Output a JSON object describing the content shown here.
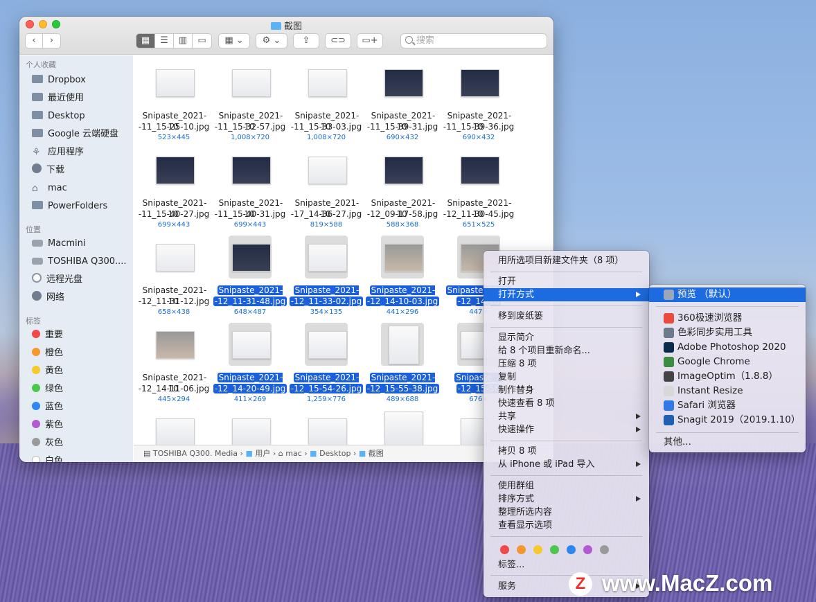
{
  "window": {
    "title": "截图",
    "search_placeholder": "搜索",
    "action_glyph": "⚙",
    "view_glyph": "▦"
  },
  "sidebar": {
    "favorites_header": "个人收藏",
    "favorites": [
      {
        "label": "Dropbox",
        "icon": "folder-icon"
      },
      {
        "label": "最近使用",
        "icon": "folder-icon"
      },
      {
        "label": "Desktop",
        "icon": "folder-icon"
      },
      {
        "label": "Google 云端硬盘",
        "icon": "folder-icon"
      },
      {
        "label": "应用程序",
        "icon": "applications-icon"
      },
      {
        "label": "下载",
        "icon": "download-icon"
      },
      {
        "label": "mac",
        "icon": "home-icon"
      },
      {
        "label": "PowerFolders",
        "icon": "folder-icon"
      }
    ],
    "locations_header": "位置",
    "locations": [
      {
        "label": "Macmini",
        "icon": "computer-icon"
      },
      {
        "label": "TOSHIBA Q300....",
        "icon": "disk-icon"
      },
      {
        "label": "远程光盘",
        "icon": "disc-icon"
      },
      {
        "label": "网络",
        "icon": "network-icon"
      }
    ],
    "tags_header": "标签",
    "tags": [
      {
        "label": "重要",
        "color": "#f0494a"
      },
      {
        "label": "橙色",
        "color": "#f5982f"
      },
      {
        "label": "黄色",
        "color": "#f5c92f"
      },
      {
        "label": "绿色",
        "color": "#4cc74c"
      },
      {
        "label": "蓝色",
        "color": "#2e86f0"
      },
      {
        "label": "紫色",
        "color": "#b45ad0"
      },
      {
        "label": "灰色",
        "color": "#9a9a9a"
      },
      {
        "label": "白色",
        "color": "#ffffff"
      }
    ]
  },
  "files": [
    [
      {
        "name1": "Snipaste_2021-10",
        "name2": "-11_15-25-10.jpg",
        "dims": "523×445",
        "sel": false
      },
      {
        "name1": "Snipaste_2021-10",
        "name2": "-11_15-32-57.jpg",
        "dims": "1,008×720",
        "sel": false
      },
      {
        "name1": "Snipaste_2021-10",
        "name2": "-11_15-33-03.jpg",
        "dims": "1,008×720",
        "sel": false
      },
      {
        "name1": "Snipaste_2021-10",
        "name2": "-11_15-39-31.jpg",
        "dims": "690×432",
        "sel": false
      },
      {
        "name1": "Snipaste_2021-10",
        "name2": "-11_15-39-36.jpg",
        "dims": "690×432",
        "sel": false
      }
    ],
    [
      {
        "name1": "Snipaste_2021-10",
        "name2": "-11_15-40-27.jpg",
        "dims": "699×443",
        "sel": false
      },
      {
        "name1": "Snipaste_2021-10",
        "name2": "-11_15-40-31.jpg",
        "dims": "699×443",
        "sel": false
      },
      {
        "name1": "Snipaste_2021-10",
        "name2": "-17_14-36-27.jpg",
        "dims": "819×588",
        "sel": false
      },
      {
        "name1": "Snipaste_2021-10",
        "name2": "-12_09-17-58.jpg",
        "dims": "588×368",
        "sel": false
      },
      {
        "name1": "Snipaste_2021-10",
        "name2": "-12_11-30-45.jpg",
        "dims": "651×525",
        "sel": false
      }
    ],
    [
      {
        "name1": "Snipaste_2021-10",
        "name2": "-12_11-31-12.jpg",
        "dims": "658×438",
        "sel": false
      },
      {
        "name1": "Snipaste_2021-10",
        "name2": "-12_11-31-48.jpg",
        "dims": "648×487",
        "sel": true
      },
      {
        "name1": "Snipaste_2021-10",
        "name2": "-12_11-33-02.jpg",
        "dims": "354×135",
        "sel": true
      },
      {
        "name1": "Snipaste_2021-10",
        "name2": "-12_14-10-03.jpg",
        "dims": "441×296",
        "sel": true
      },
      {
        "name1": "Snipaste_2021-10",
        "name2": "-12_14-10",
        "dims": "447×",
        "sel": true
      }
    ],
    [
      {
        "name1": "Snipaste_2021-10",
        "name2": "-12_14-11-06.jpg",
        "dims": "445×294",
        "sel": false
      },
      {
        "name1": "Snipaste_2021-10",
        "name2": "-12_14-20-49.jpg",
        "dims": "411×269",
        "sel": true
      },
      {
        "name1": "Snipaste_2021-10",
        "name2": "-12_15-54-26.jpg",
        "dims": "1,259×776",
        "sel": true
      },
      {
        "name1": "Snipaste_2021-10",
        "name2": "-12_15-55-38.jpg",
        "dims": "489×688",
        "sel": true
      },
      {
        "name1": "Snipaste_2",
        "name2": "-12_15-56",
        "dims": "676×",
        "sel": true
      }
    ]
  ],
  "pathbar": [
    "TOSHIBA Q300. Media",
    "用户",
    "mac",
    "Desktop",
    "截图"
  ],
  "menu": {
    "new_folder": "用所选项目新建文件夹（8 项）",
    "open": "打开",
    "open_with": "打开方式",
    "trash": "移到废纸篓",
    "get_info": "显示简介",
    "rename": "给 8 个项目重新命名...",
    "compress": "压缩 8 项",
    "duplicate": "复制",
    "alias": "制作替身",
    "quicklook": "快速查看 8 项",
    "share": "共享",
    "quick_actions": "快速操作",
    "copy": "拷贝 8 项",
    "import": "从 iPhone 或 iPad 导入",
    "use_groups": "使用群组",
    "sort_by": "排序方式",
    "clean_up": "整理所选内容",
    "view_options": "查看显示选项",
    "tags": "标签...",
    "services": "服务",
    "tag_colors": [
      "#f0494a",
      "#f5982f",
      "#f5c92f",
      "#4cc74c",
      "#2e86f0",
      "#b45ad0",
      "#9a9a9a"
    ]
  },
  "submenu": {
    "items": [
      {
        "label": "预览 （默认）",
        "icon": "preview-icon",
        "color": "#9aa7b8"
      },
      {
        "label": "360极速浏览器",
        "icon": "360-browser-icon",
        "color": "#e94b3c"
      },
      {
        "label": "色彩同步实用工具",
        "icon": "colorsync-icon",
        "color": "#6c7a8a"
      },
      {
        "label": "Adobe Photoshop 2020",
        "icon": "photoshop-icon",
        "color": "#0b2b4b"
      },
      {
        "label": "Google Chrome",
        "icon": "chrome-icon",
        "color": "#3c8d40"
      },
      {
        "label": "ImageOptim（1.8.8）",
        "icon": "imageoptim-icon",
        "color": "#444444"
      },
      {
        "label": "Instant Resize",
        "icon": "instant-resize-icon",
        "color": "#d8d8d8"
      },
      {
        "label": "Safari 浏览器",
        "icon": "safari-icon",
        "color": "#2f7ae5"
      },
      {
        "label": "Snagit 2019（2019.1.10）",
        "icon": "snagit-icon",
        "color": "#1f5fb4"
      }
    ],
    "other": "其他..."
  },
  "watermark": {
    "logo": "Z",
    "text": "www.MacZ.com"
  }
}
